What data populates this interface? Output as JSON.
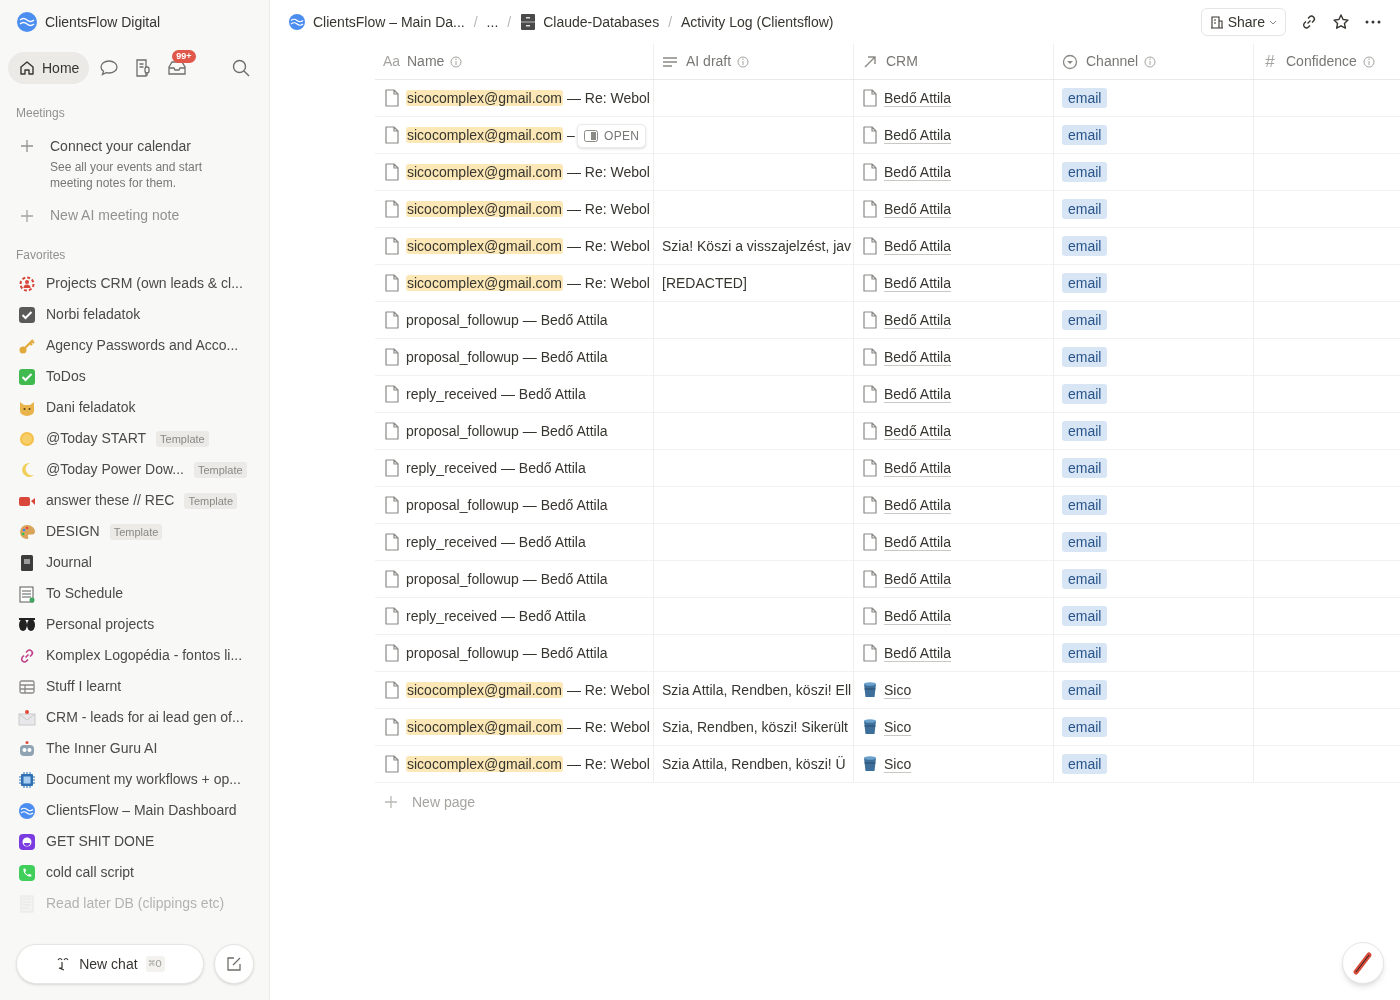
{
  "sidebar": {
    "workspace": "ClientsFlow Digital",
    "home": {
      "label": "Home",
      "selected": true
    },
    "inbox_badge": "99+",
    "meetings": {
      "heading": "Meetings",
      "connect_title": "Connect your calendar",
      "connect_description": "See all your events and start meeting notes for them.",
      "new_note": "New AI meeting note"
    },
    "favorites": {
      "heading": "Favorites",
      "items": [
        {
          "label": "Projects CRM (own leads & cl...",
          "faded": false
        },
        {
          "label": "Norbi feladatok",
          "faded": false
        },
        {
          "label": "Agency Passwords and Acco...",
          "faded": false
        },
        {
          "label": "ToDos",
          "faded": false
        },
        {
          "label": "Dani feladatok",
          "faded": false
        },
        {
          "label": "@Today START",
          "badge": "Template",
          "faded": false
        },
        {
          "label": "@Today Power Dow...",
          "badge": "Template",
          "faded": false
        },
        {
          "label": "answer these // REC",
          "badge": "Template",
          "faded": false
        },
        {
          "label": "DESIGN",
          "badge": "Template",
          "faded": false
        },
        {
          "label": "Journal",
          "faded": false
        },
        {
          "label": "To Schedule",
          "faded": false
        },
        {
          "label": "Personal projects",
          "faded": false
        },
        {
          "label": "Komplex Logopédia - fontos li...",
          "faded": false
        },
        {
          "label": "Stuff I learnt",
          "faded": false
        },
        {
          "label": "CRM - leads for ai lead gen of...",
          "faded": false
        },
        {
          "label": "The Inner Guru AI",
          "faded": false
        },
        {
          "label": "Document my workflows + op...",
          "faded": false
        },
        {
          "label": "ClientsFlow – Main Dashboard",
          "faded": false
        },
        {
          "label": "GET SHIT DONE",
          "faded": false
        },
        {
          "label": "cold call script",
          "faded": false
        },
        {
          "label": "Read later DB (clippings etc)",
          "faded": true
        }
      ]
    },
    "new_chat": {
      "label": "New chat",
      "shortcut": "⌘O"
    }
  },
  "breadcrumbs": [
    {
      "kind": "page",
      "label": "ClientsFlow – Main Da..."
    },
    {
      "kind": "separator",
      "label": "/"
    },
    {
      "kind": "more",
      "label": "..."
    },
    {
      "kind": "separator",
      "label": "/"
    },
    {
      "kind": "cabinet",
      "label": "Claude-Databases"
    },
    {
      "kind": "separator",
      "label": "/"
    },
    {
      "kind": "plain",
      "label": "Activity Log (Clientsflow)"
    }
  ],
  "share": "Share",
  "table": {
    "columns": [
      {
        "kind": "title",
        "icon_text": "Aa",
        "label": "Name",
        "info": true
      },
      {
        "kind": "text",
        "label": "AI draft",
        "info": true
      },
      {
        "kind": "relation",
        "label": "CRM",
        "info": false
      },
      {
        "kind": "select",
        "label": "Channel",
        "info": true
      },
      {
        "kind": "number",
        "icon_text": "#",
        "label": "Confidence",
        "info": true
      }
    ],
    "rows": [
      {
        "name_highlight": "sicocomplex@gmail.com",
        "name_rest": "— Re: Webol",
        "crm_database": false,
        "crm": "Bedő Attila",
        "channel": "email"
      },
      {
        "name_highlight": "sicocomplex@gmail.com",
        "name_rest": "–",
        "open_button": "OPEN",
        "crm_database": false,
        "crm": "Bedő Attila",
        "channel": "email"
      },
      {
        "name_highlight": "sicocomplex@gmail.com",
        "name_rest": "— Re: Webol",
        "crm_database": false,
        "crm": "Bedő Attila",
        "channel": "email"
      },
      {
        "name_highlight": "sicocomplex@gmail.com",
        "name_rest": "— Re: Webol",
        "crm_database": false,
        "crm": "Bedő Attila",
        "channel": "email"
      },
      {
        "name_highlight": "sicocomplex@gmail.com",
        "name_rest": "— Re: Webol",
        "ai_draft": "Szia! Köszi a visszajelzést, jav",
        "crm_database": false,
        "crm": "Bedő Attila",
        "channel": "email"
      },
      {
        "name_highlight": "sicocomplex@gmail.com",
        "name_rest": "— Re: Webol",
        "ai_draft": "[REDACTED]",
        "crm_database": false,
        "crm": "Bedő Attila",
        "channel": "email"
      },
      {
        "name_rest": "proposal_followup — Bedő Attila",
        "crm_database": false,
        "crm": "Bedő Attila",
        "channel": "email"
      },
      {
        "name_rest": "proposal_followup — Bedő Attila",
        "crm_database": false,
        "crm": "Bedő Attila",
        "channel": "email"
      },
      {
        "name_rest": "reply_received — Bedő Attila",
        "crm_database": false,
        "crm": "Bedő Attila",
        "channel": "email"
      },
      {
        "name_rest": "proposal_followup — Bedő Attila",
        "crm_database": false,
        "crm": "Bedő Attila",
        "channel": "email"
      },
      {
        "name_rest": "reply_received — Bedő Attila",
        "crm_database": false,
        "crm": "Bedő Attila",
        "channel": "email"
      },
      {
        "name_rest": "proposal_followup — Bedő Attila",
        "crm_database": false,
        "crm": "Bedő Attila",
        "channel": "email"
      },
      {
        "name_rest": "reply_received — Bedő Attila",
        "crm_database": false,
        "crm": "Bedő Attila",
        "channel": "email"
      },
      {
        "name_rest": "proposal_followup — Bedő Attila",
        "crm_database": false,
        "crm": "Bedő Attila",
        "channel": "email"
      },
      {
        "name_rest": "reply_received — Bedő Attila",
        "crm_database": false,
        "crm": "Bedő Attila",
        "channel": "email"
      },
      {
        "name_rest": "proposal_followup — Bedő Attila",
        "crm_database": false,
        "crm": "Bedő Attila",
        "channel": "email"
      },
      {
        "name_highlight": "sicocomplex@gmail.com",
        "name_rest": "— Re: Webol",
        "ai_draft": "Szia Attila, Rendben, köszi! Ell",
        "crm_database": true,
        "crm": "Sico",
        "channel": "email"
      },
      {
        "name_highlight": "sicocomplex@gmail.com",
        "name_rest": "— Re: Webol",
        "ai_draft": "Szia, Rendben, köszi! Sikerült",
        "crm_database": true,
        "crm": "Sico",
        "channel": "email"
      },
      {
        "name_highlight": "sicocomplex@gmail.com",
        "name_rest": "— Re: Webol",
        "ai_draft": "Szia Attila, Rendben, köszi! Ü",
        "crm_database": true,
        "crm": "Sico",
        "channel": "email"
      }
    ],
    "new_page": "New page"
  }
}
